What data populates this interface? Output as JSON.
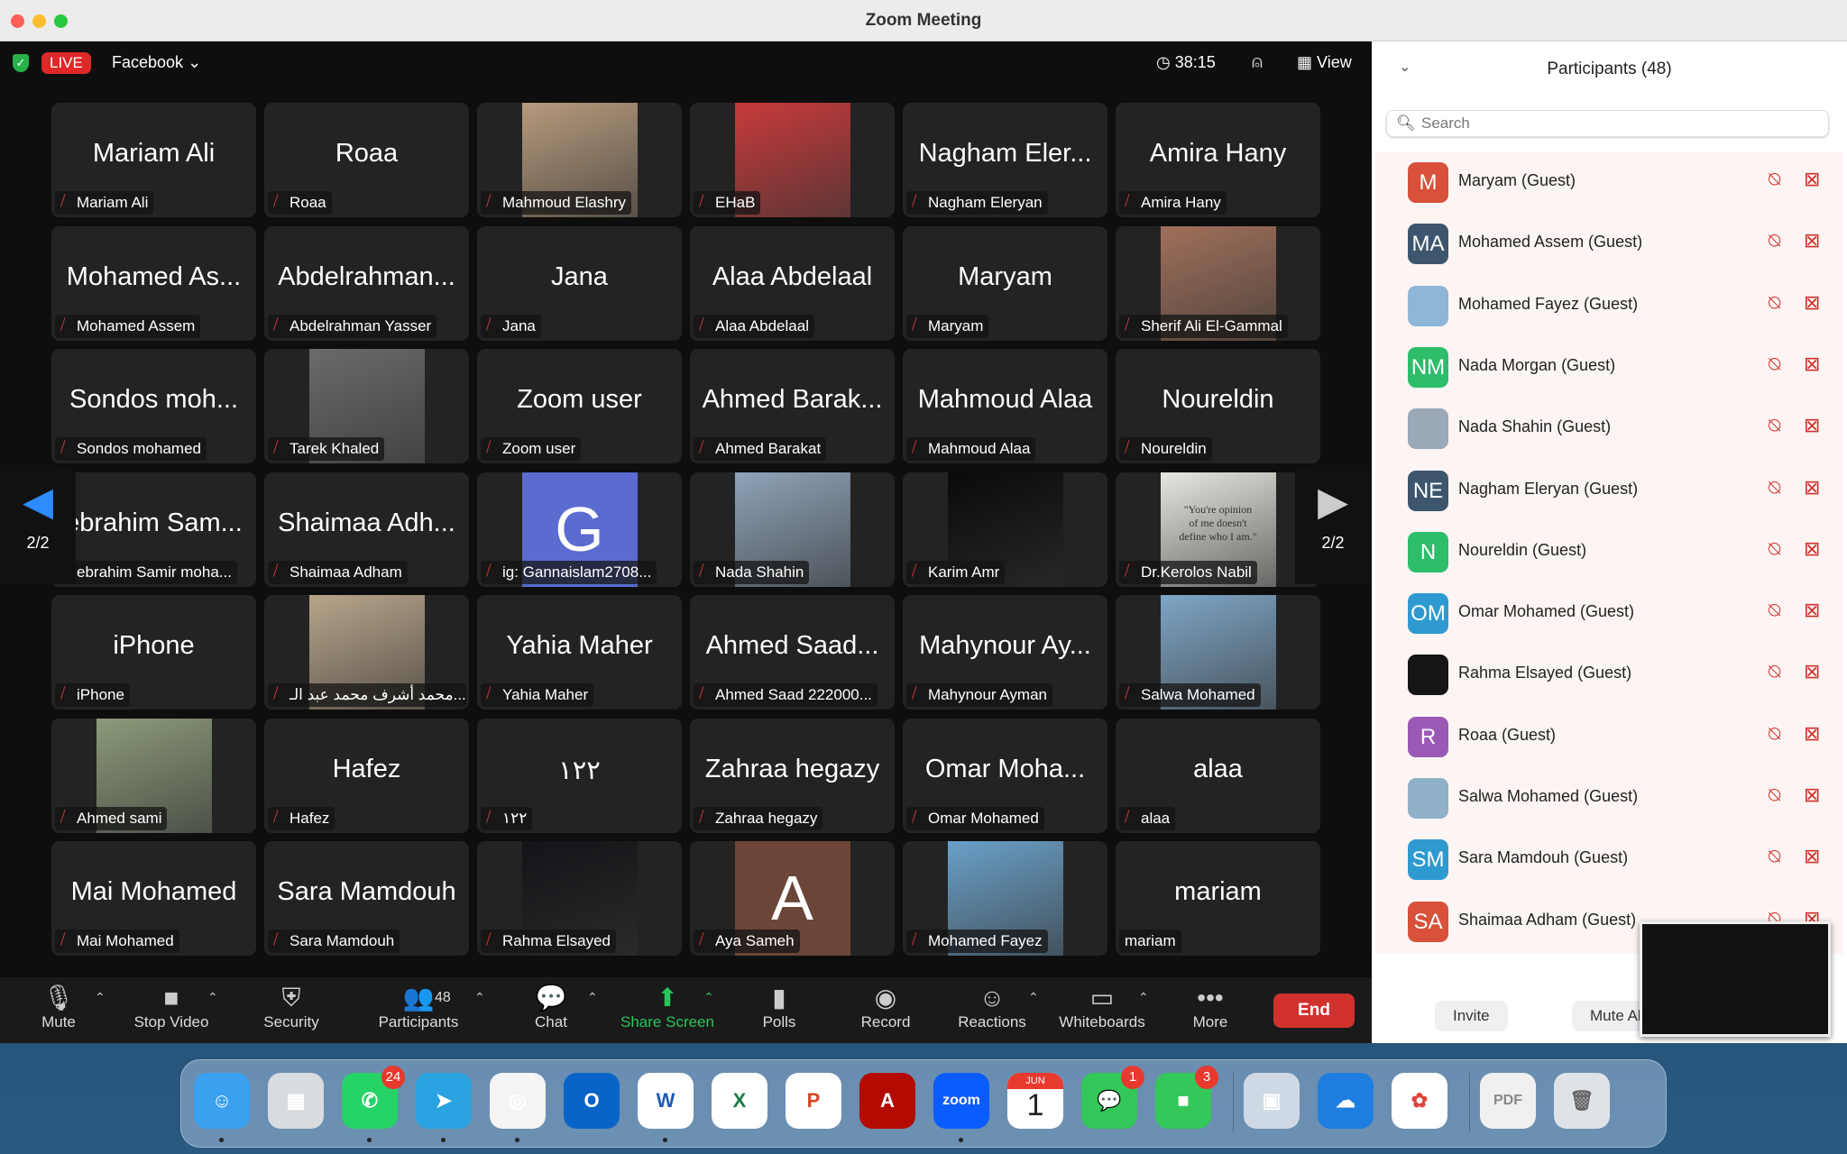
{
  "window": {
    "title": "Zoom Meeting"
  },
  "topbar": {
    "live": "LIVE",
    "stream_target": "Facebook",
    "timer": "38:15",
    "view": "View"
  },
  "pager": {
    "left": "2/2",
    "right": "2/2"
  },
  "tiles": [
    {
      "big": "Mariam Ali",
      "label": "Mariam Ali",
      "kind": "name"
    },
    {
      "big": "Roaa",
      "label": "Roaa",
      "kind": "name"
    },
    {
      "label": "Mahmoud Elashry",
      "kind": "photo",
      "color": "#b69a7c"
    },
    {
      "label": "EHaB",
      "kind": "photo",
      "color": "#c83a3a"
    },
    {
      "big": "Nagham Eler...",
      "label": "Nagham Eleryan",
      "kind": "name"
    },
    {
      "big": "Amira Hany",
      "label": "Amira Hany",
      "kind": "name"
    },
    {
      "big": "Mohamed As...",
      "label": "Mohamed Assem",
      "kind": "name"
    },
    {
      "big": "Abdelrahman...",
      "label": "Abdelrahman Yasser",
      "kind": "name"
    },
    {
      "big": "Jana",
      "label": "Jana",
      "kind": "name"
    },
    {
      "big": "Alaa Abdelaal",
      "label": "Alaa Abdelaal",
      "kind": "name"
    },
    {
      "big": "Maryam",
      "label": "Maryam",
      "kind": "name"
    },
    {
      "label": "Sherif Ali El-Gammal",
      "kind": "photo",
      "color": "#a0705a"
    },
    {
      "big": "Sondos moh...",
      "label": "Sondos mohamed",
      "kind": "name"
    },
    {
      "label": "Tarek Khaled",
      "kind": "photo",
      "color": "#6a6a6a"
    },
    {
      "big": "Zoom user",
      "label": "Zoom user",
      "kind": "name"
    },
    {
      "big": "Ahmed Barak...",
      "label": "Ahmed Barakat",
      "kind": "name"
    },
    {
      "big": "Mahmoud Alaa",
      "label": "Mahmoud Alaa",
      "kind": "name"
    },
    {
      "big": "Noureldin",
      "label": "Noureldin",
      "kind": "name"
    },
    {
      "big": "ebrahim Sam...",
      "label": "ebrahim Samir moha...",
      "kind": "name"
    },
    {
      "big": "Shaimaa Adh...",
      "label": "Shaimaa Adham",
      "kind": "name"
    },
    {
      "letter": "G",
      "label": "ig: Gannaislam2708...",
      "kind": "letter",
      "color": "#5b6bd0"
    },
    {
      "label": "Nada Shahin",
      "kind": "photo",
      "color": "#8fa3b8"
    },
    {
      "label": "Karim Amr",
      "kind": "photo",
      "color": "#0a0a0a"
    },
    {
      "label": "Dr.Kerolos Nabil",
      "kind": "photo",
      "color": "#e8e6e0",
      "caption": "\"You're opinion of me doesn't define who I am.\""
    },
    {
      "big": "iPhone",
      "label": "iPhone",
      "kind": "name"
    },
    {
      "label": "محمد أشرف محمد عبد الـ...",
      "kind": "photo",
      "color": "#b8a58a"
    },
    {
      "big": "Yahia Maher",
      "label": "Yahia Maher",
      "kind": "name"
    },
    {
      "big": "Ahmed Saad...",
      "label": "Ahmed Saad 222000...",
      "kind": "name"
    },
    {
      "big": "Mahynour Ay...",
      "label": "Mahynour Ayman",
      "kind": "name"
    },
    {
      "label": "Salwa Mohamed",
      "kind": "photo",
      "color": "#7ea6c6"
    },
    {
      "label": "Ahmed sami",
      "kind": "photo",
      "color": "#8c9a7a"
    },
    {
      "big": "Hafez",
      "label": "Hafez",
      "kind": "name"
    },
    {
      "big": "١٢٢",
      "label": "١٢٢",
      "kind": "name"
    },
    {
      "big": "Zahraa hegazy",
      "label": "Zahraa hegazy",
      "kind": "name"
    },
    {
      "big": "Omar Moha...",
      "label": "Omar Mohamed",
      "kind": "name"
    },
    {
      "big": "alaa",
      "label": "alaa",
      "kind": "name"
    },
    {
      "big": "Mai Mohamed",
      "label": "Mai Mohamed",
      "kind": "name"
    },
    {
      "big": "Sara Mamdouh",
      "label": "Sara Mamdouh",
      "kind": "name"
    },
    {
      "label": "Rahma Elsayed",
      "kind": "photo",
      "color": "#141418"
    },
    {
      "letter": "A",
      "label": "Aya Sameh",
      "kind": "letter",
      "color": "#6b4638"
    },
    {
      "label": "Mohamed Fayez",
      "kind": "photo",
      "color": "#6aa0c8"
    },
    {
      "big": "mariam",
      "label": "mariam",
      "kind": "name",
      "unmuted": true
    }
  ],
  "toolbar": [
    {
      "label": "Mute",
      "icon": "microphone-icon",
      "glyph": "🎙"
    },
    {
      "label": "Stop Video",
      "icon": "video-camera-icon",
      "glyph": "■"
    },
    {
      "label": "Security",
      "icon": "shield-icon",
      "glyph": "⛨"
    },
    {
      "label": "Participants",
      "icon": "participants-icon",
      "glyph": "👥",
      "count": "48"
    },
    {
      "label": "Chat",
      "icon": "chat-icon",
      "glyph": "💬"
    },
    {
      "label": "Share Screen",
      "icon": "share-screen-icon",
      "glyph": "⬆"
    },
    {
      "label": "Polls",
      "icon": "polls-icon",
      "glyph": "▮"
    },
    {
      "label": "Record",
      "icon": "record-icon",
      "glyph": "◉"
    },
    {
      "label": "Reactions",
      "icon": "reactions-icon",
      "glyph": "☺"
    },
    {
      "label": "Whiteboards",
      "icon": "whiteboard-icon",
      "glyph": "▭"
    },
    {
      "label": "More",
      "icon": "more-icon",
      "glyph": "•••"
    }
  ],
  "end_label": "End",
  "panel": {
    "title": "Participants (48)",
    "search_placeholder": "Search",
    "invite": "Invite",
    "mute_all": "Mute All",
    "participants": [
      {
        "name": "Maryam (Guest)",
        "initials": "M",
        "color": "#d9513a"
      },
      {
        "name": "Mohamed Assem (Guest)",
        "initials": "MA",
        "color": "#3d566e"
      },
      {
        "name": "Mohamed Fayez (Guest)",
        "initials": "",
        "color": "#8fb6d6"
      },
      {
        "name": "Nada Morgan (Guest)",
        "initials": "NM",
        "color": "#2ebd6b"
      },
      {
        "name": "Nada Shahin (Guest)",
        "initials": "",
        "color": "#9aa8b8"
      },
      {
        "name": "Nagham Eleryan (Guest)",
        "initials": "NE",
        "color": "#3d566e"
      },
      {
        "name": "Noureldin (Guest)",
        "initials": "N",
        "color": "#2ebd6b"
      },
      {
        "name": "Omar Mohamed (Guest)",
        "initials": "OM",
        "color": "#2e9ad0"
      },
      {
        "name": "Rahma Elsayed (Guest)",
        "initials": "",
        "color": "#151515"
      },
      {
        "name": "Roaa (Guest)",
        "initials": "R",
        "color": "#9b59b6"
      },
      {
        "name": "Salwa Mohamed (Guest)",
        "initials": "",
        "color": "#8fb0c6"
      },
      {
        "name": "Sara Mamdouh (Guest)",
        "initials": "SM",
        "color": "#2e9ad0"
      },
      {
        "name": "Shaimaa Adham (Guest)",
        "initials": "SA",
        "color": "#d9513a"
      }
    ]
  },
  "dock": [
    {
      "name": "finder",
      "bg": "#3aa0f0",
      "glyph": "☺",
      "running": true
    },
    {
      "name": "launchpad",
      "bg": "#d8dbe0",
      "glyph": "▦"
    },
    {
      "name": "whatsapp",
      "bg": "#25d366",
      "glyph": "✆",
      "badge": "24",
      "running": true
    },
    {
      "name": "telegram",
      "bg": "#2aa3e0",
      "glyph": "➤",
      "running": true
    },
    {
      "name": "chrome",
      "bg": "#f4f4f4",
      "glyph": "◎",
      "running": true
    },
    {
      "name": "outlook",
      "bg": "#0a64c8",
      "glyph": "O"
    },
    {
      "name": "word",
      "bg": "#fff",
      "glyph": "W",
      "fg": "#1f5bb5",
      "running": true
    },
    {
      "name": "excel",
      "bg": "#fff",
      "glyph": "X",
      "fg": "#1d7a45"
    },
    {
      "name": "powerpoint",
      "bg": "#fff",
      "glyph": "P",
      "fg": "#d24726"
    },
    {
      "name": "acrobat",
      "bg": "#b30b00",
      "glyph": "A"
    },
    {
      "name": "zoom",
      "bg": "#0b5cff",
      "glyph": "zoom",
      "running": true
    },
    {
      "name": "calendar",
      "bg": "#fff",
      "glyph": "1",
      "fg": "#222",
      "month": "JUN"
    },
    {
      "name": "messages",
      "bg": "#34c759",
      "glyph": "💬",
      "badge": "1"
    },
    {
      "name": "facetime",
      "bg": "#34c759",
      "glyph": "■",
      "badge": "3"
    },
    {
      "name": "preview",
      "bg": "#cfd9e6",
      "glyph": "▣",
      "sep": true
    },
    {
      "name": "weather",
      "bg": "#1e7ee0",
      "glyph": "☁"
    },
    {
      "name": "photos",
      "bg": "#fff",
      "glyph": "✿",
      "fg": "#e0443b"
    },
    {
      "name": "pdf-document",
      "bg": "#f0f0f0",
      "glyph": "PDF",
      "fg": "#888",
      "sep": true
    },
    {
      "name": "trash",
      "bg": "#dfe3e8",
      "glyph": "🗑",
      "fg": "#666"
    }
  ]
}
